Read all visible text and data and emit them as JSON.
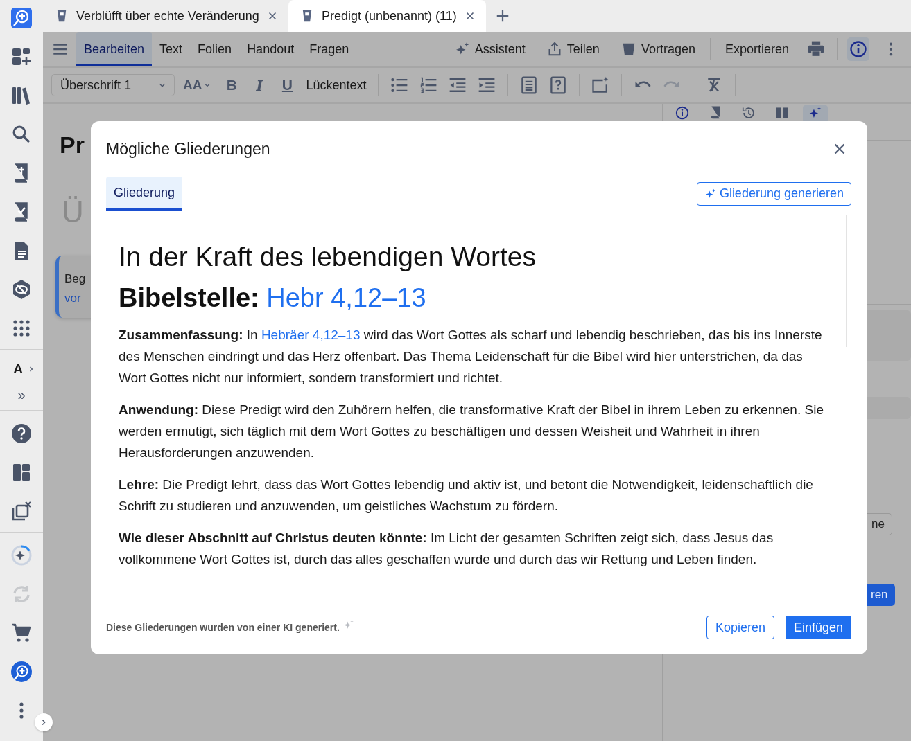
{
  "doc_tabs": [
    {
      "title": "Verblüfft über echte Veränderung",
      "selected": false
    },
    {
      "title": "Predigt (unbenannt) (11)",
      "selected": true
    }
  ],
  "sidebar": {
    "font_label": "A",
    "more_label": "»"
  },
  "menu_tabs": [
    {
      "label": "Bearbeiten",
      "selected": true
    },
    {
      "label": "Text",
      "selected": false
    },
    {
      "label": "Folien",
      "selected": false
    },
    {
      "label": "Handout",
      "selected": false
    },
    {
      "label": "Fragen",
      "selected": false
    }
  ],
  "actions": [
    {
      "kind": "assistant",
      "label": "Assistent"
    },
    {
      "kind": "share",
      "label": "Teilen"
    },
    {
      "kind": "present",
      "label": "Vortragen"
    },
    {
      "kind": "export",
      "label": "Exportieren"
    }
  ],
  "info_button": {
    "selected": true
  },
  "format_bar": {
    "style_value": "Überschrift 1",
    "font_size_label": "AA",
    "format_buttons": [
      {
        "kind": "bold",
        "label": "B"
      },
      {
        "kind": "italic",
        "label": "I"
      },
      {
        "kind": "underline",
        "label": "U"
      }
    ],
    "cloze_label": "Lückentext"
  },
  "editor": {
    "title": "Pr",
    "placeholder": "Ü",
    "card": {
      "line_1": "Beg",
      "line_2": "vor"
    }
  },
  "side_panel": {
    "tabs": [
      {
        "selected": false
      },
      {
        "selected": false
      },
      {
        "selected": false
      },
      {
        "selected": false
      },
      {
        "selected": true
      }
    ],
    "button_1": "ne",
    "button_2": "ren"
  },
  "dialog": {
    "title": "Mögliche Gliederungen",
    "tabs": [
      {
        "label": "Gliederung",
        "selected": true
      }
    ],
    "generate_button": "Gliederung generieren",
    "heading": "In der Kraft des lebendigen Wortes",
    "passage": {
      "label": "Bibelstelle:",
      "link": "Hebr 4,12–13"
    },
    "sections": [
      {
        "label": "Zusammenfassung:",
        "segments": [
          {
            "text": "In "
          },
          {
            "link": "Hebräer 4,12–13"
          },
          {
            "text": " wird das Wort Gottes als scharf und lebendig beschrieben, das bis ins Innerste des Menschen eindringt und das Herz offenbart. Das Thema Leidenschaft für die Bibel wird hier unterstrichen, da das Wort Gottes nicht nur informiert, sondern transformiert und richtet."
          }
        ]
      },
      {
        "label": "Anwendung:",
        "segments": [
          {
            "text": "Diese Predigt wird den Zuhörern helfen, die transformative Kraft der Bibel in ihrem Leben zu erkennen. Sie werden ermutigt, sich täglich mit dem Wort Gottes zu beschäftigen und dessen Weisheit und Wahrheit in ihren Herausforderungen anzuwenden."
          }
        ]
      },
      {
        "label": "Lehre:",
        "segments": [
          {
            "text": "Die Predigt lehrt, dass das Wort Gottes lebendig und aktiv ist, und betont die Notwendigkeit, leidenschaftlich die Schrift zu studieren und anzuwenden, um geistliches Wachstum zu fördern."
          }
        ]
      },
      {
        "label": "Wie dieser Abschnitt auf Christus deuten könnte:",
        "segments": [
          {
            "text": "Im Licht der gesamten Schriften zeigt sich, dass Jesus das vollkommene Wort Gottes ist, durch das alles geschaffen wurde und durch das wir Rettung und Leben finden."
          }
        ]
      }
    ],
    "footer_note": "Diese Gliederungen wurden von einer KI generiert.",
    "buttons": [
      {
        "kind": "secondary",
        "label": "Kopieren"
      },
      {
        "kind": "primary",
        "label": "Einfügen"
      }
    ]
  }
}
